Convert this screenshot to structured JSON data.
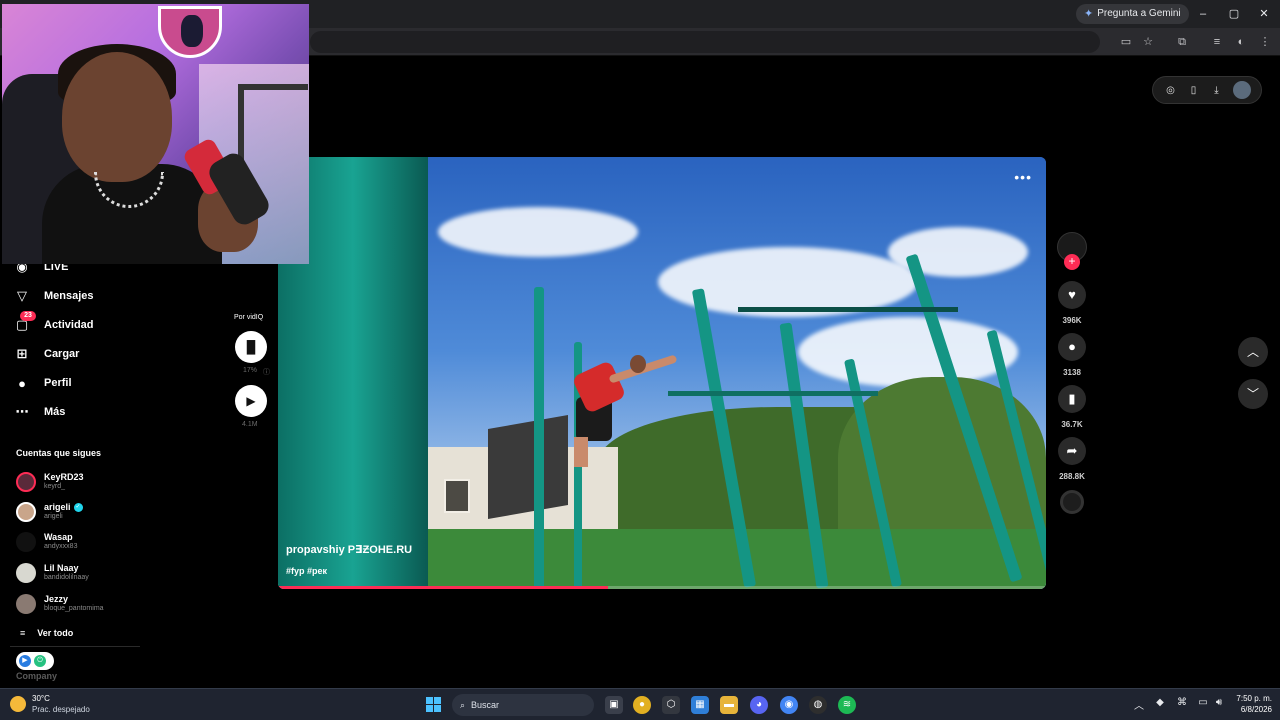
{
  "browser": {
    "gemini_label": "Pregunta a Gemini",
    "window_controls": [
      "–",
      "▢",
      "✕"
    ]
  },
  "sidebar": {
    "nav": [
      {
        "label": "LIVE",
        "icon": "live-icon"
      },
      {
        "label": "Mensajes",
        "icon": "messages-icon"
      },
      {
        "label": "Actividad",
        "icon": "activity-icon",
        "badge": "23"
      },
      {
        "label": "Cargar",
        "icon": "upload-icon"
      },
      {
        "label": "Perfil",
        "icon": "profile-icon"
      },
      {
        "label": "Más",
        "icon": "more-icon"
      }
    ],
    "following_title": "Cuentas que sigues",
    "following": [
      {
        "name": "KeyRD23",
        "handle": "keyrd_"
      },
      {
        "name": "arigeli",
        "handle": "arigeli",
        "verified": true
      },
      {
        "name": "Wasap",
        "handle": "andyxxx83"
      },
      {
        "name": "Lil Naay",
        "handle": "bandidolilnaay"
      },
      {
        "name": "Jezzy",
        "handle": "bloque_pantomima"
      }
    ],
    "see_all": "Ver todo",
    "company": "Company"
  },
  "vidiq": {
    "label": "Por vidIQ",
    "percent": "17%",
    "views": "4.1M"
  },
  "video": {
    "author": "propavshiy P∃ƵOHE.RU",
    "tags": "#fyp #рек",
    "progress": 0.43
  },
  "actions": {
    "likes": "396K",
    "comments": "3138",
    "saves": "36.7K",
    "shares": "288.8K"
  },
  "taskbar": {
    "weather_temp": "30°C",
    "weather_desc": "Prac. despejado",
    "search_placeholder": "Buscar",
    "time": "7:50 p. m.",
    "date": "6/8/2026"
  },
  "colors": {
    "accent": "#fe2c55",
    "verified": "#20d5ec",
    "taskbar": "#1f2430"
  }
}
